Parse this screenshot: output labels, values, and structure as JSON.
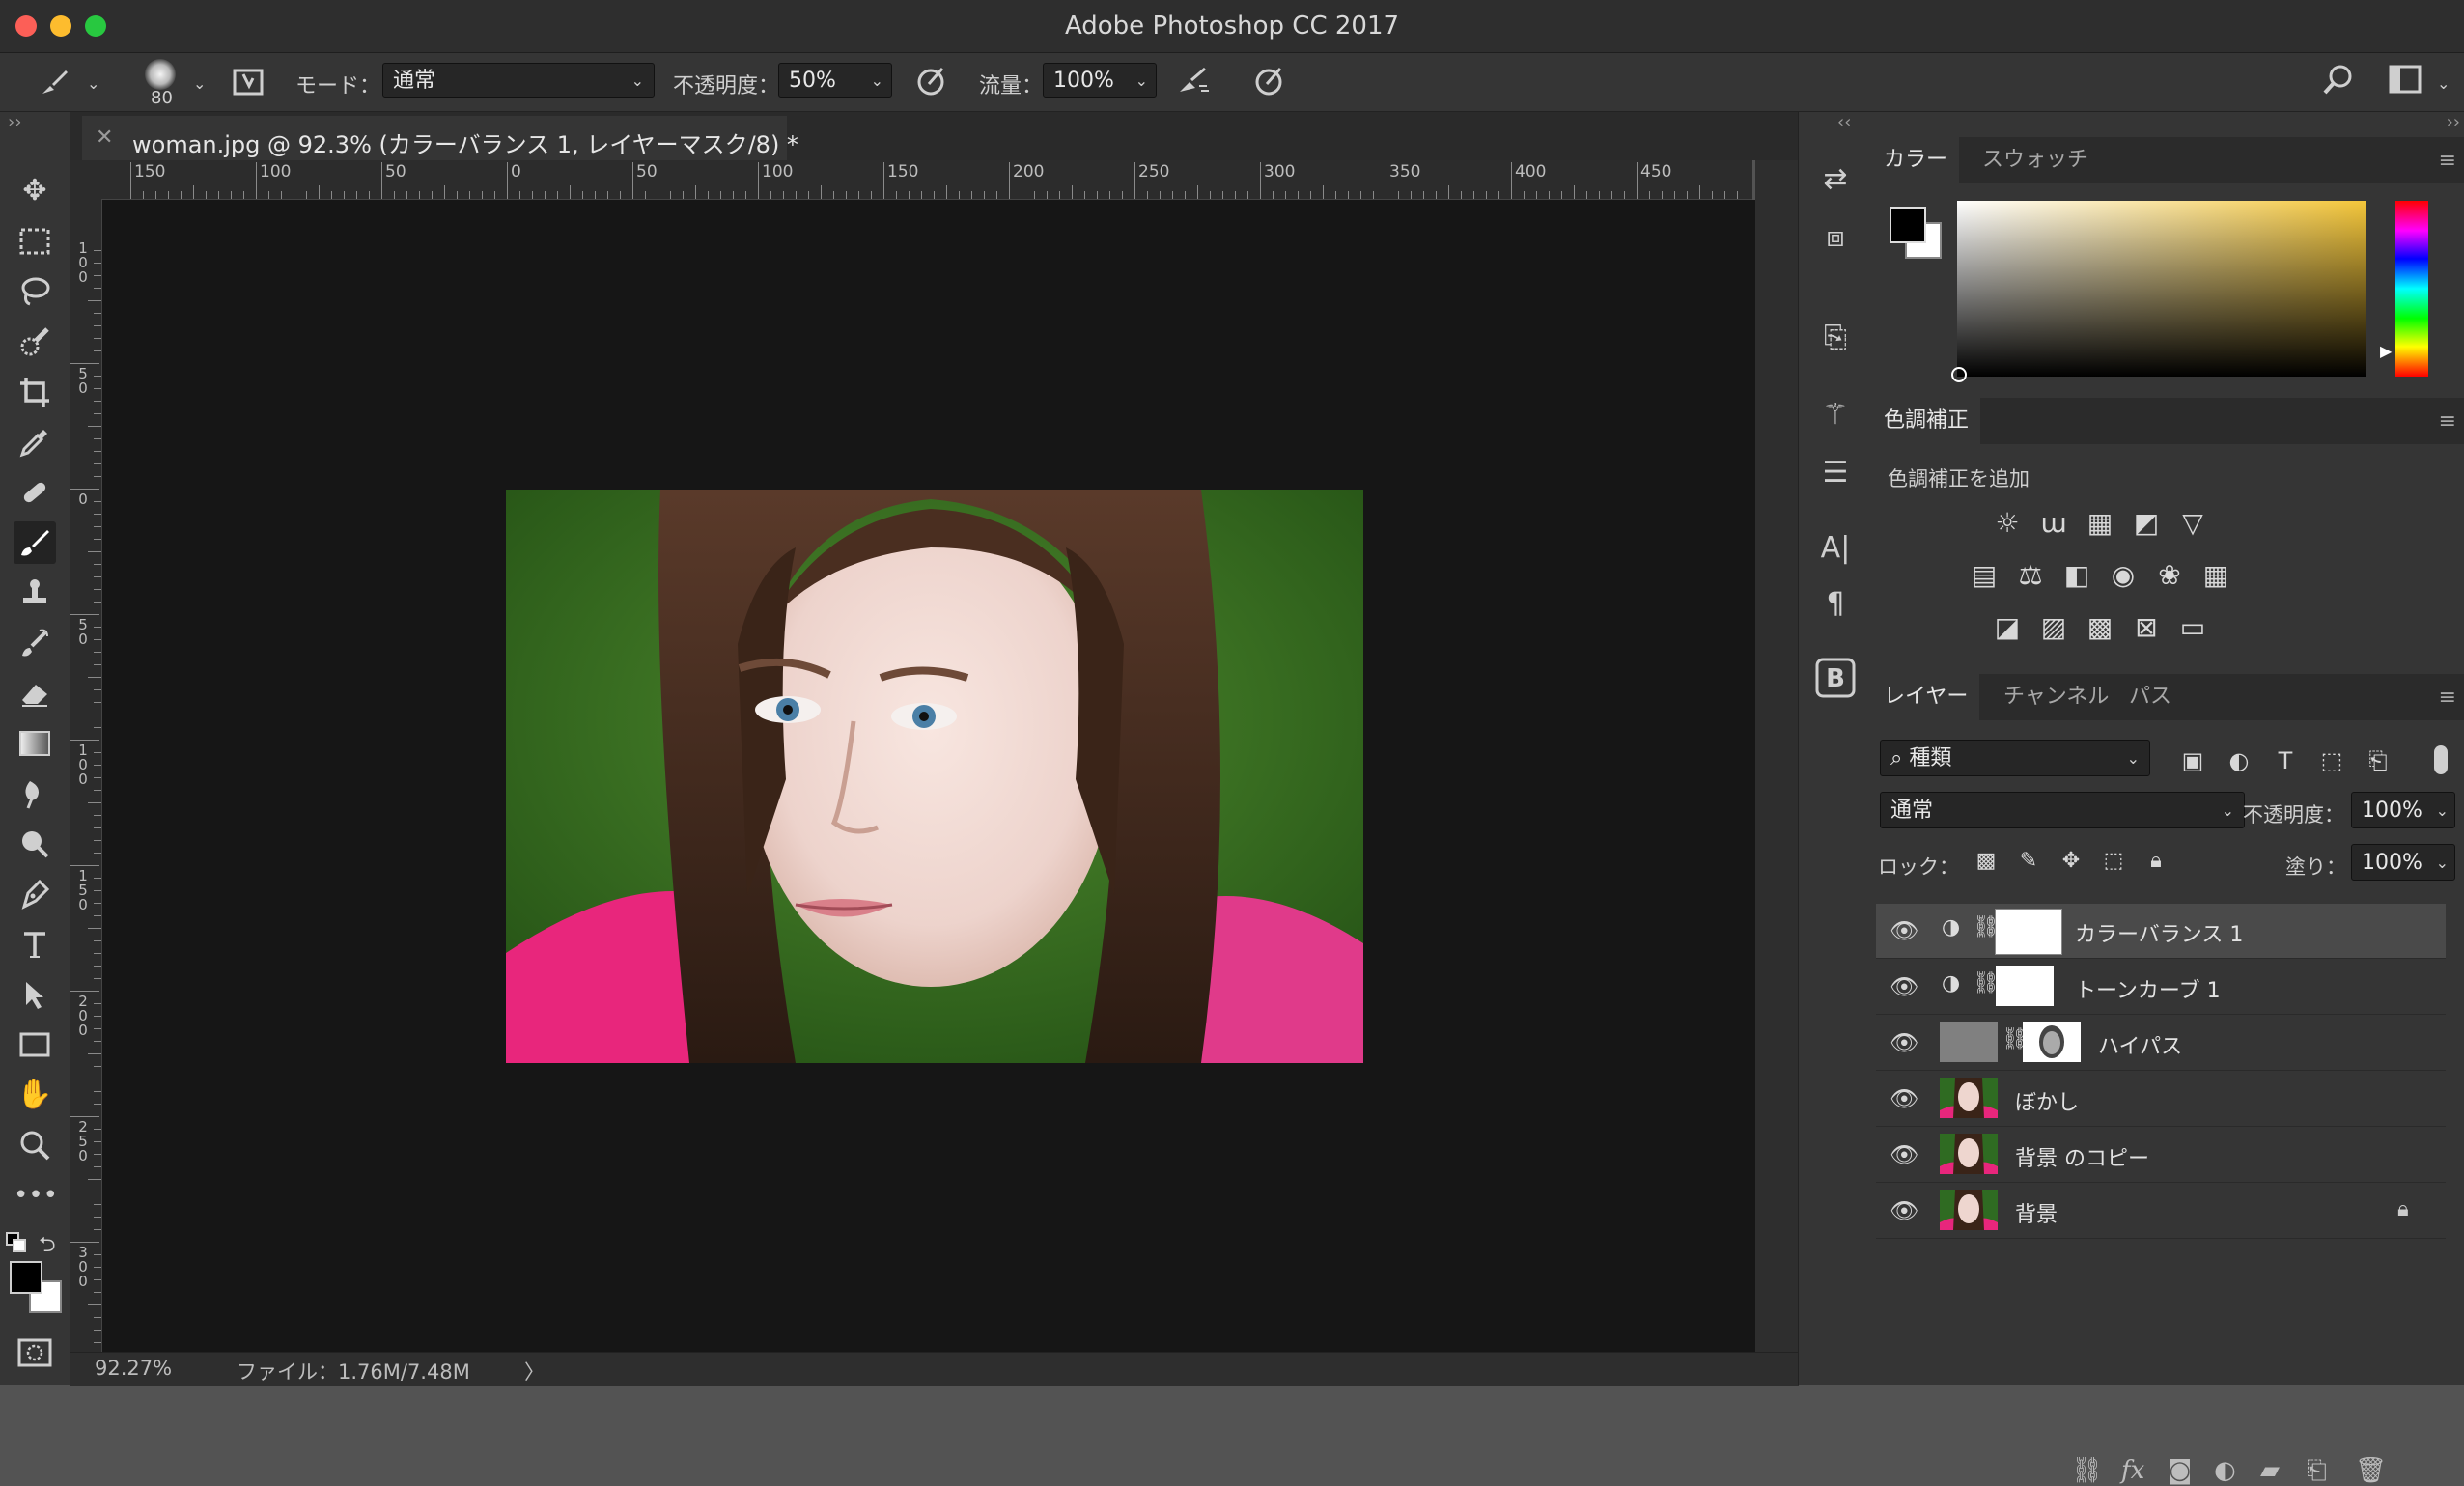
{
  "window": {
    "title": "Adobe Photoshop CC 2017"
  },
  "options": {
    "brush_size": "80",
    "mode_label": "モード：",
    "mode_value": "通常",
    "opacity_label": "不透明度：",
    "opacity_value": "50%",
    "flow_label": "流量：",
    "flow_value": "100%"
  },
  "document": {
    "tab_title": "woman.jpg @ 92.3% (カラーバランス 1, レイヤーマスク/8) *",
    "ruler_h_labels": [
      "150",
      "100",
      "50",
      "0",
      "50",
      "100",
      "150",
      "200",
      "250",
      "300",
      "350",
      "400",
      "450"
    ],
    "ruler_v_labels": [
      "100",
      "50",
      "0",
      "50",
      "100",
      "150",
      "200",
      "250",
      "300"
    ]
  },
  "status": {
    "zoom": "92.27%",
    "file": "ファイル：1.76M/7.48M",
    "arrow": "〉"
  },
  "color_panel": {
    "tabs": [
      "カラー",
      "スウォッチ"
    ]
  },
  "adjustments_panel": {
    "tab": "色調補正",
    "add_label": "色調補正を追加"
  },
  "layers_panel": {
    "tabs": [
      "レイヤー",
      "チャンネル",
      "パス"
    ],
    "filter_kind": "種類",
    "blend_mode": "通常",
    "opacity_label": "不透明度：",
    "opacity_value": "100%",
    "lock_label": "ロック：",
    "fill_label": "塗り：",
    "fill_value": "100%",
    "layers": [
      {
        "name": "カラーバランス 1",
        "type": "adjustment"
      },
      {
        "name": "トーンカーブ 1",
        "type": "adjustment"
      },
      {
        "name": "ハイパス",
        "type": "filter"
      },
      {
        "name": "ぼかし",
        "type": "photo"
      },
      {
        "name": "背景 のコピー",
        "type": "photo"
      },
      {
        "name": "背景",
        "type": "photo-locked"
      }
    ]
  },
  "colors": {
    "accent_pink": "#e8267c",
    "bg_green": "#2f6b22"
  }
}
